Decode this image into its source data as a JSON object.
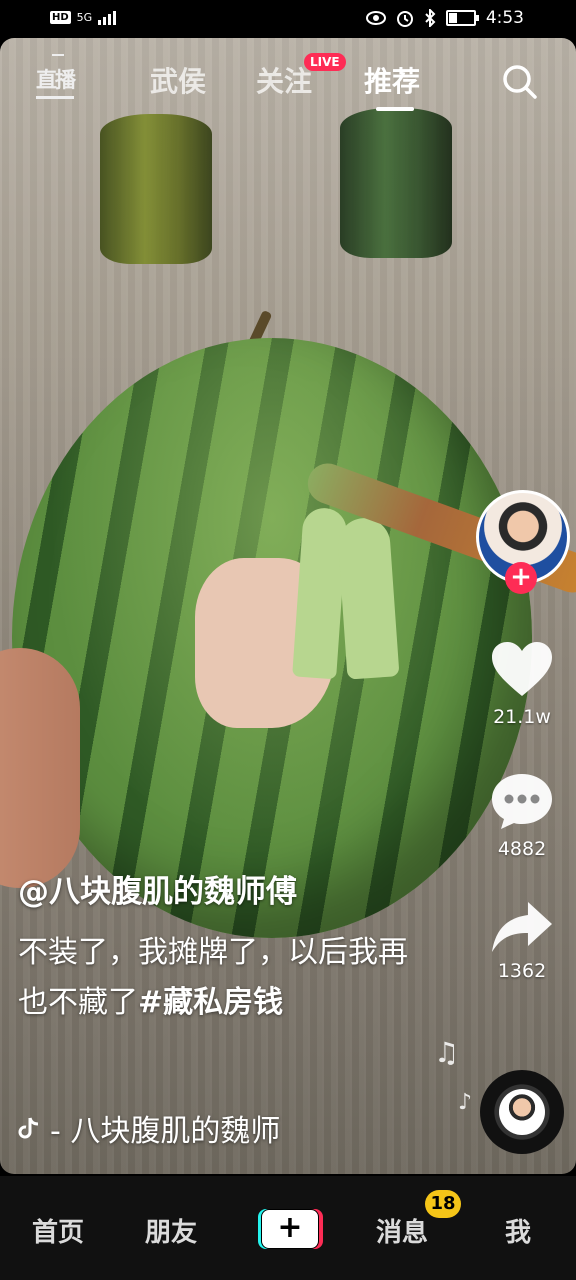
{
  "status_bar": {
    "network_badge": "HD",
    "network_type": "5G",
    "time": "4:53",
    "icons": [
      "eye-icon",
      "alarm-icon",
      "bluetooth-icon",
      "battery-icon"
    ]
  },
  "top_nav": {
    "live_entry": "直播",
    "tabs": [
      {
        "label": "武侯"
      },
      {
        "label": "关注"
      },
      {
        "label": "推荐"
      }
    ],
    "live_badge": "LIVE",
    "active_tab": "推荐"
  },
  "video": {
    "author": "@八块腹肌的魏师傅",
    "description": "不装了，我摊牌了，以后我再也不藏了",
    "hashtag": "#藏私房钱",
    "music": "- 八块腹肌的魏师"
  },
  "actions": {
    "likes": "21.1w",
    "comments": "4882",
    "shares": "1362"
  },
  "bottom_nav": {
    "home": "首页",
    "friends": "朋友",
    "create": "+",
    "messages": "消息",
    "messages_badge": "18",
    "me": "我"
  },
  "colors": {
    "accent": "#fe2c55",
    "cyan": "#25f4ee",
    "badge": "#f5c518"
  }
}
